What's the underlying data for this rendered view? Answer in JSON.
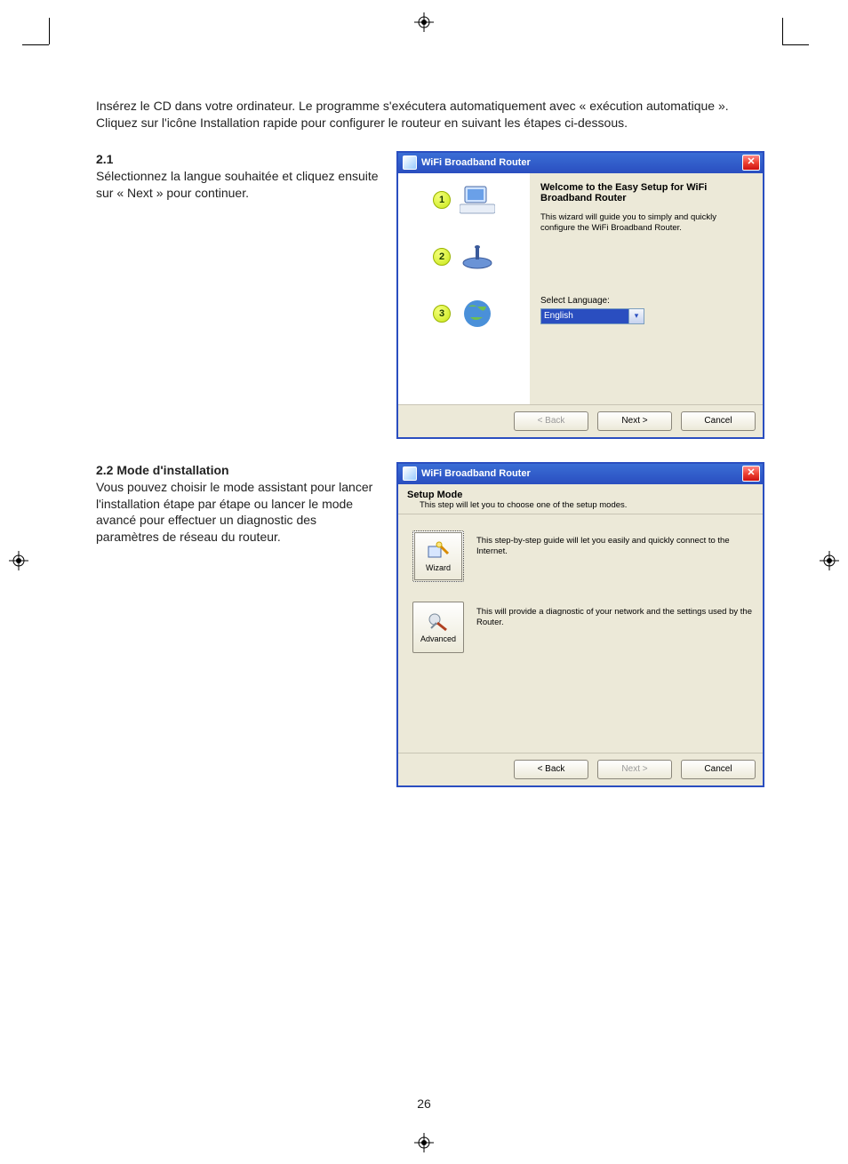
{
  "intro_text": "Insérez le CD dans votre ordinateur. Le programme s'exécutera automatiquement avec « exécution automatique ». Cliquez sur l'icône Installation rapide pour configurer le routeur en suivant les étapes ci-dessous.",
  "section_21": {
    "num": "2.1",
    "body": "Sélectionnez la langue souhaitée et cliquez ensuite sur « Next » pour continuer."
  },
  "section_22": {
    "num": "2.2",
    "title": "Mode d'installation",
    "body": "Vous pouvez choisir le mode assistant pour lancer l'installation étape par étape ou lancer le mode avancé pour effectuer un diagnostic des paramètres de réseau du routeur."
  },
  "dialog1": {
    "title": "WiFi Broadband Router",
    "steps": [
      "1",
      "2",
      "3"
    ],
    "welcome": "Welcome to the Easy Setup for WiFi Broadband Router",
    "desc": "This wizard will guide you to simply and quickly configure the WiFi Broadband Router.",
    "lang_label": "Select Language:",
    "lang_value": "English",
    "buttons": {
      "back": "< Back",
      "next": "Next >",
      "cancel": "Cancel"
    }
  },
  "dialog2": {
    "title": "WiFi Broadband Router",
    "header_title": "Setup Mode",
    "header_sub": "This step will let you to choose one of the setup modes.",
    "wizard_label": "Wizard",
    "wizard_desc": "This step-by-step guide will let you easily and quickly connect to the Internet.",
    "advanced_label": "Advanced",
    "advanced_desc": "This will provide a diagnostic of your network and the settings used by the Router.",
    "buttons": {
      "back": "< Back",
      "next": "Next >",
      "cancel": "Cancel"
    }
  },
  "page_number": "26"
}
